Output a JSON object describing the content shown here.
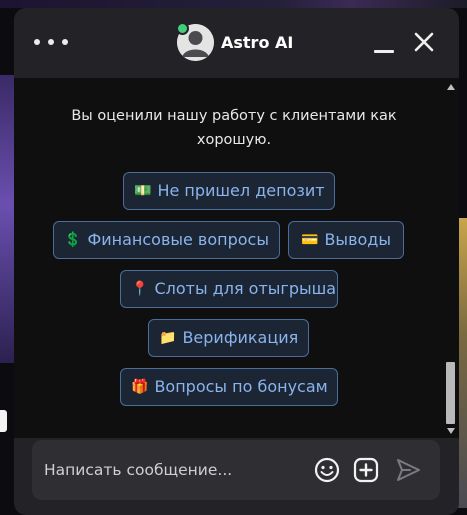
{
  "header": {
    "title": "Astro AI",
    "menu_icon": "more-dots-icon",
    "avatar_icon": "user-avatar-icon",
    "online_color": "#3fd07a",
    "minimize_icon": "minimize-icon",
    "close_icon": "close-icon"
  },
  "chat": {
    "status_message": "Вы оценили нашу работу с клиентами как хорошую.",
    "quick_replies": [
      {
        "emoji": "💵",
        "label": "Не пришел депозит"
      },
      {
        "emoji": "💲",
        "label": "Финансовые вопросы"
      },
      {
        "emoji": "💳",
        "label": "Выводы"
      },
      {
        "emoji": "📍",
        "label": "Слоты для отыгрыша"
      },
      {
        "emoji": "📁",
        "label": "Верификация"
      },
      {
        "emoji": "🎁",
        "label": "Вопросы по бонусам"
      }
    ]
  },
  "composer": {
    "placeholder": "Написать сообщение...",
    "emoji_icon": "smiley-icon",
    "attach_icon": "plus-square-icon",
    "send_icon": "send-icon"
  },
  "colors": {
    "accent_text": "#89b4ec",
    "accent_border": "#4b6d9a",
    "panel": "#232327",
    "chat_bg": "#0f0f10"
  }
}
